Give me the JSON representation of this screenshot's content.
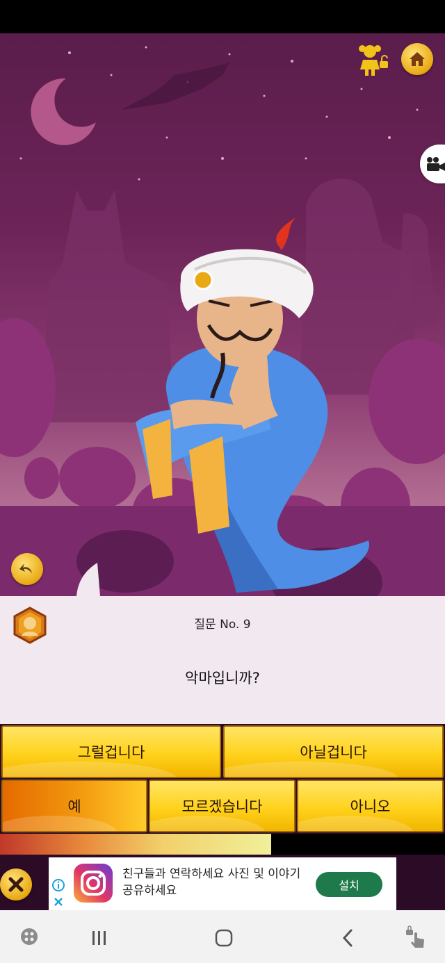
{
  "question": {
    "number_label": "질문 No. 9",
    "text": "악마입니까?"
  },
  "answers": {
    "probably": "그럴겁니다",
    "probably_not": "아닐겁니다",
    "yes": "예",
    "dont_know": "모르겠습니다",
    "no": "아니오"
  },
  "progress": {
    "fraction": 0.61
  },
  "ad": {
    "text": "친구들과 연락하세요 사진 및 이야기 공유하세요",
    "install_label": "설치"
  },
  "icons": {
    "kid_mode": "child-lock-icon",
    "home": "home-icon",
    "camera": "video-camera-icon",
    "undo": "undo-icon",
    "avatar": "avatar-badge-icon",
    "close": "close-icon",
    "ad_info": "info-icon",
    "ad_close": "x-icon",
    "nav_game": "game-icon",
    "nav_recents": "recents-icon",
    "nav_home": "home-nav-icon",
    "nav_back": "back-icon",
    "nav_accessibility": "touch-icon"
  },
  "colors": {
    "button_gold": "#ffd21c",
    "button_active": "#f39a10",
    "install_green": "#1e7a4a",
    "scene_purple": "#6d2458"
  }
}
